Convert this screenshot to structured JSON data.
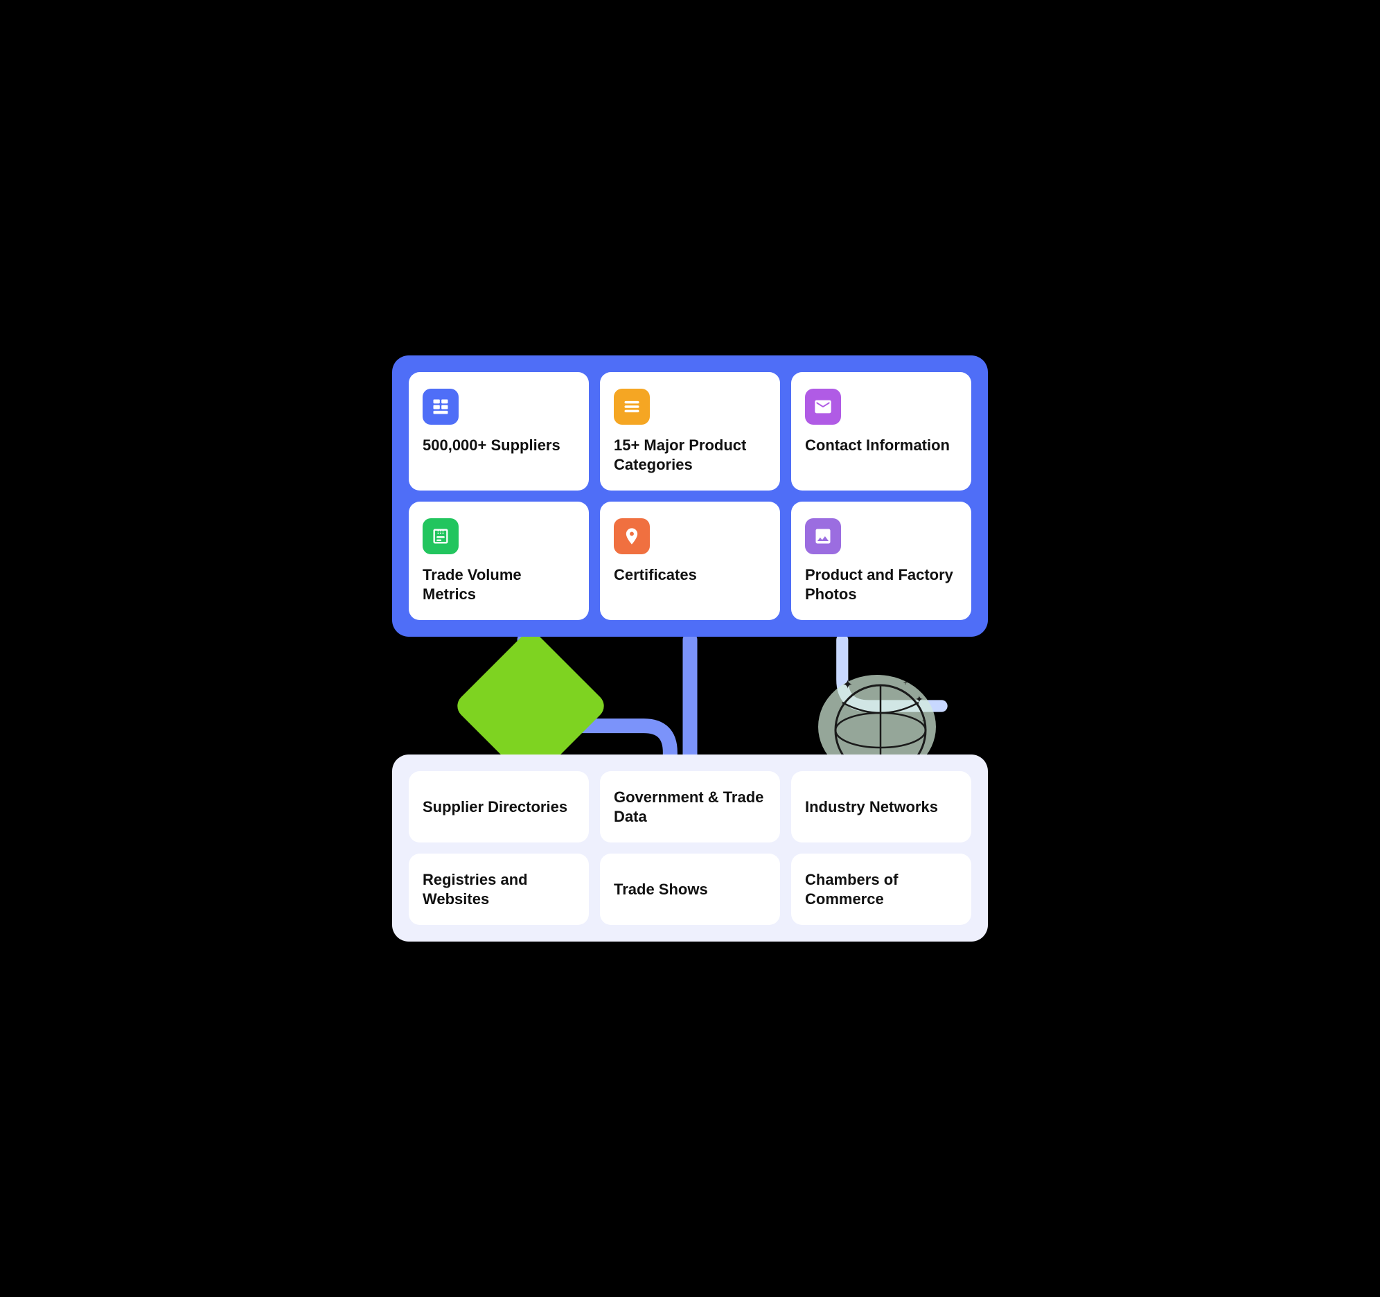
{
  "top_section": {
    "features": [
      {
        "id": "suppliers",
        "icon": "suppliers",
        "badge_class": "badge-blue",
        "title": "500,000+ Suppliers"
      },
      {
        "id": "categories",
        "icon": "categories",
        "badge_class": "badge-orange",
        "title": "15+ Major Product Categories"
      },
      {
        "id": "contact",
        "icon": "contact",
        "badge_class": "badge-purple",
        "title": "Contact Information"
      },
      {
        "id": "trade-volume",
        "icon": "trade",
        "badge_class": "badge-green",
        "title": "Trade Volume Metrics"
      },
      {
        "id": "certificates",
        "icon": "certificates",
        "badge_class": "badge-red-orange",
        "title": "Certificates"
      },
      {
        "id": "photos",
        "icon": "photos",
        "badge_class": "badge-purple2",
        "title": "Product and Factory Photos"
      }
    ]
  },
  "bottom_section": {
    "sources": [
      {
        "id": "supplier-dirs",
        "title": "Supplier Directories"
      },
      {
        "id": "gov-trade",
        "title": "Government & Trade Data"
      },
      {
        "id": "industry-networks",
        "title": "Industry Networks"
      },
      {
        "id": "registries",
        "title": "Registries and Websites"
      },
      {
        "id": "trade-shows",
        "title": "Trade Shows"
      },
      {
        "id": "chambers",
        "title": "Chambers of Commerce"
      }
    ]
  }
}
